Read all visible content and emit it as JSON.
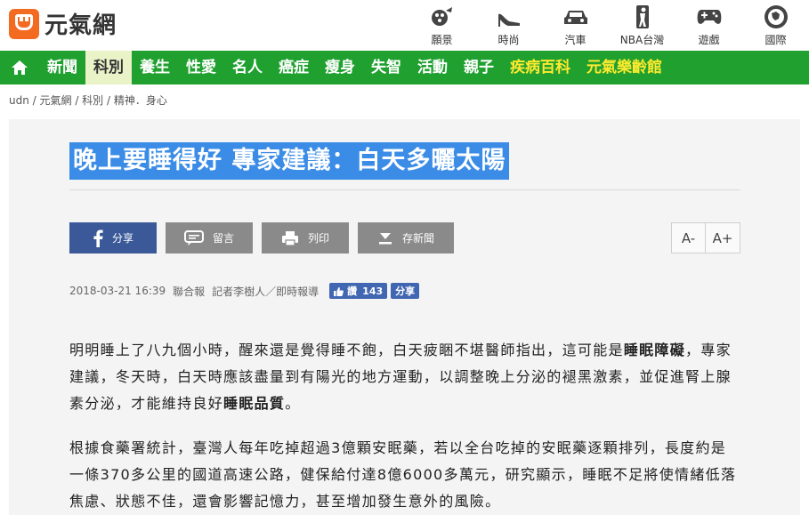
{
  "header": {
    "logo_text": "元氣網",
    "icons": [
      {
        "label": "願景",
        "icon": "vision-icon"
      },
      {
        "label": "時尚",
        "icon": "high-heel-icon"
      },
      {
        "label": "汽車",
        "icon": "car-icon"
      },
      {
        "label": "NBA台灣",
        "icon": "nba-icon"
      },
      {
        "label": "遊戲",
        "icon": "gamepad-icon"
      },
      {
        "label": "國際",
        "icon": "globe-icon"
      }
    ]
  },
  "nav": {
    "items": [
      {
        "label": "新聞"
      },
      {
        "label": "科別"
      },
      {
        "label": "養生"
      },
      {
        "label": "性愛"
      },
      {
        "label": "名人"
      },
      {
        "label": "癌症"
      },
      {
        "label": "瘦身"
      },
      {
        "label": "失智"
      },
      {
        "label": "活動"
      },
      {
        "label": "親子"
      },
      {
        "label": "疾病百科"
      },
      {
        "label": "元氣樂齡館"
      }
    ]
  },
  "breadcrumb": "udn / 元氣網 / 科別 / 精神．身心",
  "article": {
    "title": "晚上要睡得好 專家建議：白天多曬太陽",
    "buttons": {
      "share": "分享",
      "comment": "留言",
      "print": "列印",
      "save": "存新聞"
    },
    "font_smaller": "A-",
    "font_larger": "A+",
    "date": "2018-03-21 16:39",
    "source": "聯合報",
    "reporter": "記者李樹人／即時報導",
    "like_label": "讚",
    "like_count": "143",
    "share_small": "分享",
    "p1_a": "明明睡上了八九個小時，醒來還是覺得睡不飽，白天疲睏不堪醫師指出，這可能是",
    "p1_b": "睡眠障礙",
    "p1_c": "，專家建議，冬天時，白天時應該盡量到有陽光的地方運動，以調整晚上分泌的褪黑激素，並促進腎上腺素分泌，才能維持良好",
    "p1_d": "睡眠品質",
    "p1_e": "。",
    "p2": "根據食藥署統計，臺灣人每年吃掉超過3億顆安眠藥，若以全台吃掉的安眠藥逐顆排列，長度約是一條370多公里的國道高速公路，健保給付達8億6000多萬元，研究顯示，睡眠不足將使情緒低落焦慮、狀態不佳，還會影響記憶力，甚至增加發生意外的風險。"
  }
}
